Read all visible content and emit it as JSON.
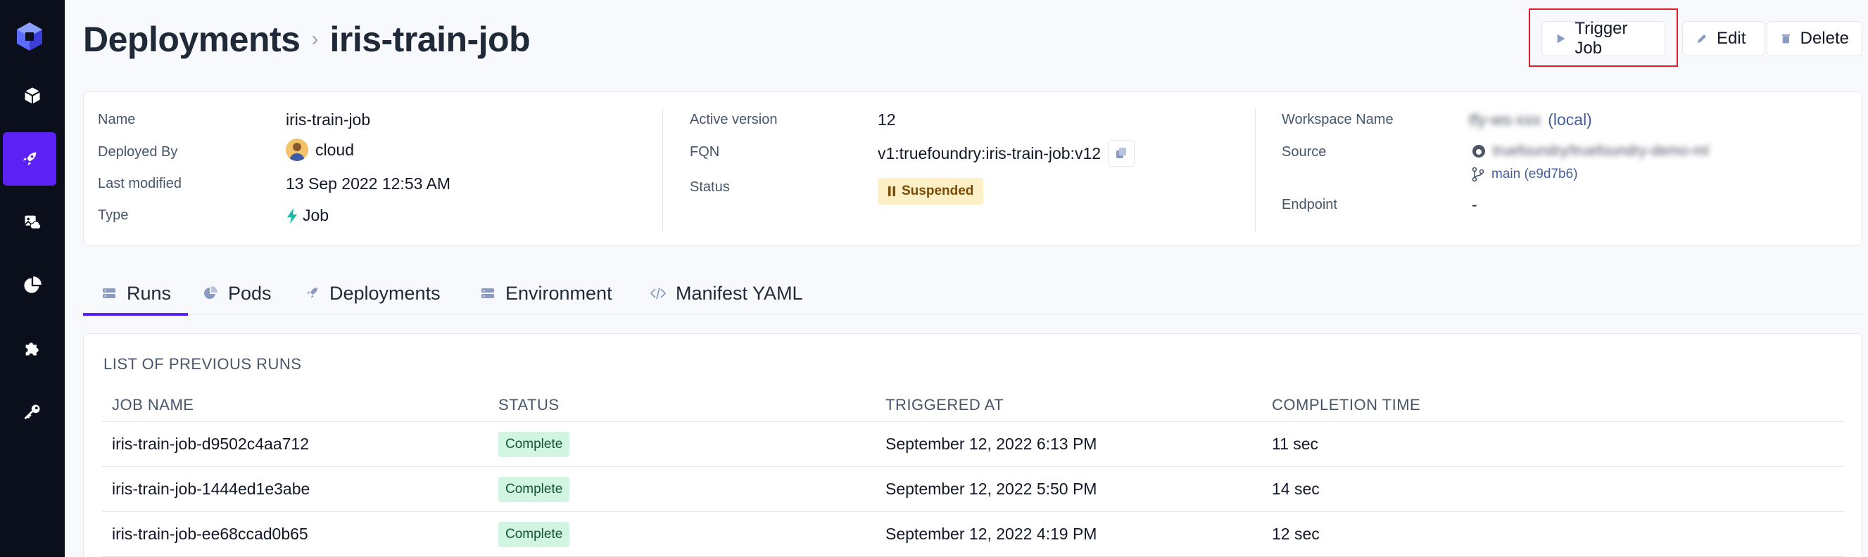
{
  "sidebar": {
    "items": [
      {
        "icon": "cube-icon"
      },
      {
        "icon": "rocket-icon",
        "active": true
      },
      {
        "icon": "image-cloud-icon"
      },
      {
        "icon": "pie-chart-icon"
      },
      {
        "icon": "puzzle-icon"
      },
      {
        "icon": "key-icon"
      }
    ]
  },
  "header": {
    "breadcrumb_root": "Deployments",
    "separator": "›",
    "title": "iris-train-job",
    "trigger_label": "Trigger Job",
    "edit_label": "Edit",
    "delete_label": "Delete"
  },
  "info": {
    "name_label": "Name",
    "name_value": "iris-train-job",
    "deployed_by_label": "Deployed By",
    "deployed_by_value": "cloud",
    "last_modified_label": "Last modified",
    "last_modified_value": "13 Sep 2022 12:53 AM",
    "type_label": "Type",
    "type_value": "Job",
    "active_version_label": "Active version",
    "active_version_value": "12",
    "fqn_label": "FQN",
    "fqn_value": "v1:truefoundry:iris-train-job:v12",
    "status_label": "Status",
    "status_value": "Suspended",
    "workspace_label": "Workspace Name",
    "workspace_blurred": "tfy-ws-xxx",
    "workspace_suffix": "(local)",
    "source_label": "Source",
    "source_blurred": "truefoundry/truefoundry-demo-ml",
    "source_branch": "main (e9d7b6)",
    "endpoint_label": "Endpoint",
    "endpoint_value": "-"
  },
  "tabs": [
    {
      "label": "Runs",
      "icon": "server-icon",
      "active": true
    },
    {
      "label": "Pods",
      "icon": "pie-chart-icon"
    },
    {
      "label": "Deployments",
      "icon": "rocket-icon"
    },
    {
      "label": "Environment",
      "icon": "server-icon"
    },
    {
      "label": "Manifest YAML",
      "icon": "code-icon"
    }
  ],
  "runs": {
    "title": "LIST OF PREVIOUS RUNS",
    "columns": [
      "JOB NAME",
      "STATUS",
      "TRIGGERED AT",
      "COMPLETION TIME"
    ],
    "rows": [
      {
        "job": "iris-train-job-d9502c4aa712",
        "status": "Complete",
        "triggered": "September 12, 2022 6:13 PM",
        "completion": "11 sec"
      },
      {
        "job": "iris-train-job-1444ed1e3abe",
        "status": "Complete",
        "triggered": "September 12, 2022 5:50 PM",
        "completion": "14 sec"
      },
      {
        "job": "iris-train-job-ee68ccad0b65",
        "status": "Complete",
        "triggered": "September 12, 2022 4:19 PM",
        "completion": "12 sec"
      }
    ]
  },
  "colors": {
    "accent": "#5b21f5",
    "sidebar_bg": "#0b0f1c",
    "suspended_bg": "#fdf0c7",
    "complete_bg": "#d1f5e1",
    "highlight": "#e11d2b"
  }
}
